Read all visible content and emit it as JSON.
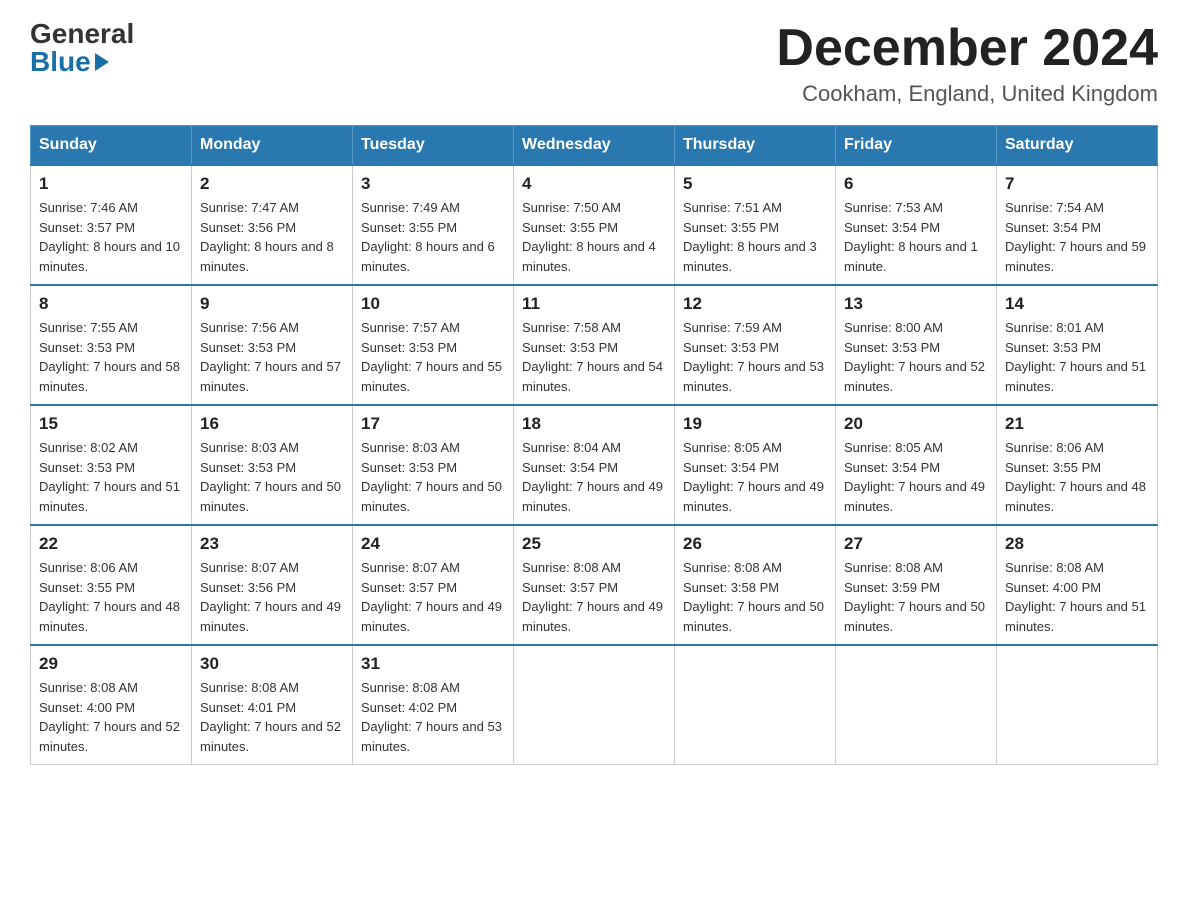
{
  "logo": {
    "general": "General",
    "blue": "Blue"
  },
  "header": {
    "title": "December 2024",
    "subtitle": "Cookham, England, United Kingdom"
  },
  "calendar": {
    "days_of_week": [
      "Sunday",
      "Monday",
      "Tuesday",
      "Wednesday",
      "Thursday",
      "Friday",
      "Saturday"
    ],
    "weeks": [
      [
        {
          "day": "1",
          "sunrise": "7:46 AM",
          "sunset": "3:57 PM",
          "daylight": "8 hours and 10 minutes."
        },
        {
          "day": "2",
          "sunrise": "7:47 AM",
          "sunset": "3:56 PM",
          "daylight": "8 hours and 8 minutes."
        },
        {
          "day": "3",
          "sunrise": "7:49 AM",
          "sunset": "3:55 PM",
          "daylight": "8 hours and 6 minutes."
        },
        {
          "day": "4",
          "sunrise": "7:50 AM",
          "sunset": "3:55 PM",
          "daylight": "8 hours and 4 minutes."
        },
        {
          "day": "5",
          "sunrise": "7:51 AM",
          "sunset": "3:55 PM",
          "daylight": "8 hours and 3 minutes."
        },
        {
          "day": "6",
          "sunrise": "7:53 AM",
          "sunset": "3:54 PM",
          "daylight": "8 hours and 1 minute."
        },
        {
          "day": "7",
          "sunrise": "7:54 AM",
          "sunset": "3:54 PM",
          "daylight": "7 hours and 59 minutes."
        }
      ],
      [
        {
          "day": "8",
          "sunrise": "7:55 AM",
          "sunset": "3:53 PM",
          "daylight": "7 hours and 58 minutes."
        },
        {
          "day": "9",
          "sunrise": "7:56 AM",
          "sunset": "3:53 PM",
          "daylight": "7 hours and 57 minutes."
        },
        {
          "day": "10",
          "sunrise": "7:57 AM",
          "sunset": "3:53 PM",
          "daylight": "7 hours and 55 minutes."
        },
        {
          "day": "11",
          "sunrise": "7:58 AM",
          "sunset": "3:53 PM",
          "daylight": "7 hours and 54 minutes."
        },
        {
          "day": "12",
          "sunrise": "7:59 AM",
          "sunset": "3:53 PM",
          "daylight": "7 hours and 53 minutes."
        },
        {
          "day": "13",
          "sunrise": "8:00 AM",
          "sunset": "3:53 PM",
          "daylight": "7 hours and 52 minutes."
        },
        {
          "day": "14",
          "sunrise": "8:01 AM",
          "sunset": "3:53 PM",
          "daylight": "7 hours and 51 minutes."
        }
      ],
      [
        {
          "day": "15",
          "sunrise": "8:02 AM",
          "sunset": "3:53 PM",
          "daylight": "7 hours and 51 minutes."
        },
        {
          "day": "16",
          "sunrise": "8:03 AM",
          "sunset": "3:53 PM",
          "daylight": "7 hours and 50 minutes."
        },
        {
          "day": "17",
          "sunrise": "8:03 AM",
          "sunset": "3:53 PM",
          "daylight": "7 hours and 50 minutes."
        },
        {
          "day": "18",
          "sunrise": "8:04 AM",
          "sunset": "3:54 PM",
          "daylight": "7 hours and 49 minutes."
        },
        {
          "day": "19",
          "sunrise": "8:05 AM",
          "sunset": "3:54 PM",
          "daylight": "7 hours and 49 minutes."
        },
        {
          "day": "20",
          "sunrise": "8:05 AM",
          "sunset": "3:54 PM",
          "daylight": "7 hours and 49 minutes."
        },
        {
          "day": "21",
          "sunrise": "8:06 AM",
          "sunset": "3:55 PM",
          "daylight": "7 hours and 48 minutes."
        }
      ],
      [
        {
          "day": "22",
          "sunrise": "8:06 AM",
          "sunset": "3:55 PM",
          "daylight": "7 hours and 48 minutes."
        },
        {
          "day": "23",
          "sunrise": "8:07 AM",
          "sunset": "3:56 PM",
          "daylight": "7 hours and 49 minutes."
        },
        {
          "day": "24",
          "sunrise": "8:07 AM",
          "sunset": "3:57 PM",
          "daylight": "7 hours and 49 minutes."
        },
        {
          "day": "25",
          "sunrise": "8:08 AM",
          "sunset": "3:57 PM",
          "daylight": "7 hours and 49 minutes."
        },
        {
          "day": "26",
          "sunrise": "8:08 AM",
          "sunset": "3:58 PM",
          "daylight": "7 hours and 50 minutes."
        },
        {
          "day": "27",
          "sunrise": "8:08 AM",
          "sunset": "3:59 PM",
          "daylight": "7 hours and 50 minutes."
        },
        {
          "day": "28",
          "sunrise": "8:08 AM",
          "sunset": "4:00 PM",
          "daylight": "7 hours and 51 minutes."
        }
      ],
      [
        {
          "day": "29",
          "sunrise": "8:08 AM",
          "sunset": "4:00 PM",
          "daylight": "7 hours and 52 minutes."
        },
        {
          "day": "30",
          "sunrise": "8:08 AM",
          "sunset": "4:01 PM",
          "daylight": "7 hours and 52 minutes."
        },
        {
          "day": "31",
          "sunrise": "8:08 AM",
          "sunset": "4:02 PM",
          "daylight": "7 hours and 53 minutes."
        },
        null,
        null,
        null,
        null
      ]
    ]
  }
}
